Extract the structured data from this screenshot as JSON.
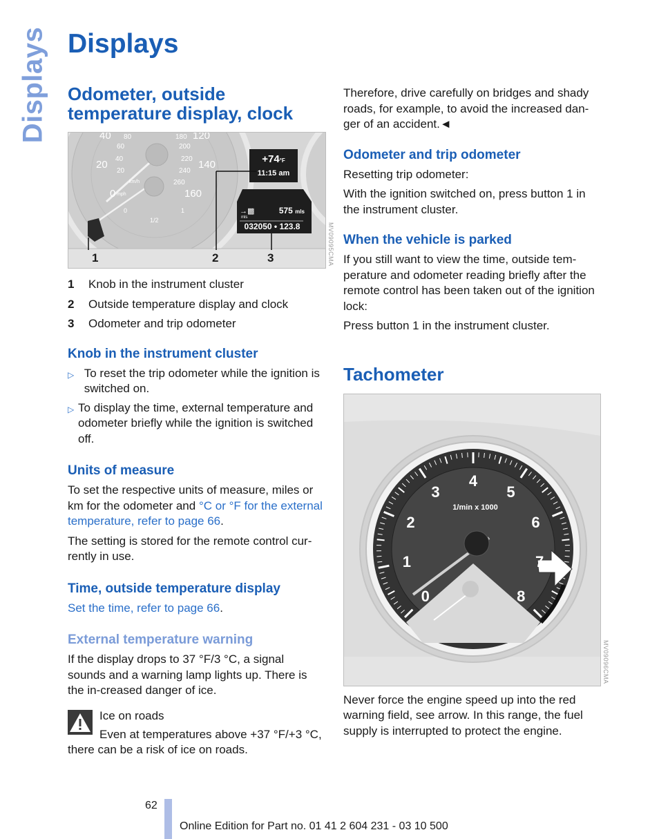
{
  "side_tab": "Displays",
  "page_title": "Displays",
  "left": {
    "section_title": "Odometer, outside temperature display, clock",
    "figure1": {
      "id": "MV09095CMA",
      "speedo_mph": [
        "0",
        "20",
        "40"
      ],
      "speedo_mph_label": "mph",
      "speedo_kmh": [
        "20",
        "40",
        "60",
        "80"
      ],
      "speedo_kmh_label": "km/h",
      "speedo_right_mph": [
        "120",
        "140",
        "160"
      ],
      "speedo_right_kmh": [
        "180",
        "200",
        "220",
        "240",
        "260"
      ],
      "fuel_marks": [
        "0",
        "1/2",
        "1"
      ],
      "temperature": "+74",
      "temperature_unit": "°F",
      "clock": "11:15 am",
      "range_value": "575",
      "range_unit": "mls",
      "odo_unit": "mls",
      "odometer": "032050",
      "trip": "123.8",
      "callouts": [
        "1",
        "2",
        "3"
      ]
    },
    "legend": [
      {
        "num": "1",
        "text": "Knob in the instrument cluster"
      },
      {
        "num": "2",
        "text": "Outside temperature display and clock"
      },
      {
        "num": "3",
        "text": "Odometer and trip odometer"
      }
    ],
    "knob": {
      "title": "Knob in the instrument cluster",
      "bullets": [
        "To reset the trip odometer while the ignition is switched on.",
        "To display the time, external temperature and odometer briefly while the ignition is switched off."
      ]
    },
    "units": {
      "title": "Units of measure",
      "p1_a": "To set the respective units of measure, miles or km for the odometer and ",
      "p1_link": "°C or °F for the external temperature, refer to page 66",
      "p1_end": ".",
      "p2": "The setting is stored for the remote control cur-rently in use."
    },
    "time": {
      "title": "Time, outside temperature display",
      "link": "Set the time, refer to page 66",
      "end": "."
    },
    "ext_warning": {
      "title": "External temperature warning",
      "text": "If the display drops to 37 °F/3 °C, a signal sounds and a warning lamp lights up. There is the in-creased danger of ice.",
      "warn_title": "Ice on roads",
      "warn_text": "Even at temperatures above +37 °F/+3 °C, there can be a risk of ice on roads."
    }
  },
  "right": {
    "cont_text": "Therefore, drive carefully on bridges and shady roads, for example, to avoid the increased dan-ger of an accident.◄",
    "odo": {
      "title": "Odometer and trip odometer",
      "p1": "Resetting trip odometer:",
      "p2": "With the ignition switched on, press button 1 in the instrument cluster."
    },
    "parked": {
      "title": "When the vehicle is parked",
      "p1": "If you still want to view the time, outside tem-perature and odometer reading briefly after the remote control has been taken out of the ignition lock:",
      "p2": "Press button 1 in the instrument cluster."
    },
    "tacho": {
      "title": "Tachometer",
      "figure_id": "MV09096CMA",
      "scale_label": "1/min x 1000",
      "numbers": [
        "0",
        "1",
        "2",
        "3",
        "4",
        "5",
        "6",
        "7",
        "8"
      ],
      "text": "Never force the engine speed up into the red warning field, see arrow. In this range, the fuel supply is interrupted to protect the engine."
    }
  },
  "footer": {
    "page_number": "62",
    "text": "Online Edition for Part no. 01 41 2 604 231 - 03 10 500"
  }
}
